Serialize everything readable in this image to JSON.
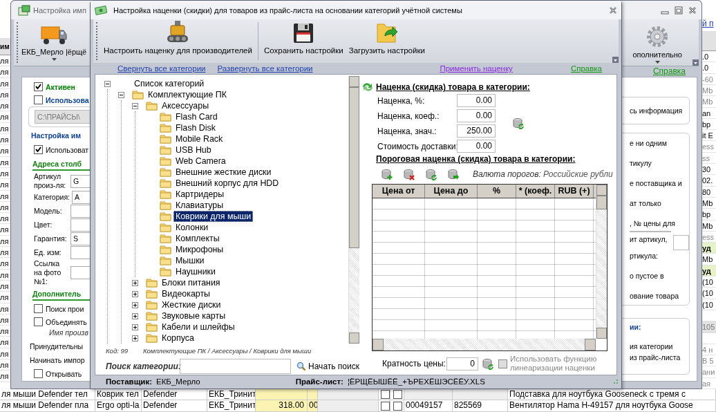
{
  "sheet": {
    "left_header": "им",
    "left_rows": [
      "ля",
      "ля",
      "ля",
      "ля",
      "ля",
      "ля",
      "ля",
      "ля",
      "ля",
      "ля",
      "ля",
      "ля",
      "ля",
      "ля",
      "ля",
      "ля",
      "ля",
      "ля",
      "ля",
      "ля",
      "ля",
      "ля",
      "ля",
      "ля",
      "ля",
      "ля",
      "ля",
      "ля",
      "ля"
    ],
    "right_link": "й п",
    "right_rows": [
      {
        "kind": "head"
      },
      {
        "kind": "plain",
        "text": ".0"
      },
      {
        "kind": "plain",
        "text": ".0"
      },
      {
        "kind": "dim",
        "text": "-60"
      },
      {
        "kind": "dim",
        "text": "Mb"
      },
      {
        "kind": "dim",
        "text": "Mb"
      },
      {
        "kind": "plain",
        "text": "an"
      },
      {
        "kind": "plain",
        "text": "bp"
      },
      {
        "kind": "plain",
        "text": "it E"
      },
      {
        "kind": "dim",
        "text": "ess"
      },
      {
        "kind": "dim",
        "text": "ss"
      },
      {
        "kind": "plain",
        "text": "30"
      },
      {
        "kind": "plain",
        "text": "02."
      },
      {
        "kind": "plain",
        "text": "80"
      },
      {
        "kind": "plain",
        "text": "Mb"
      },
      {
        "kind": "plain",
        "text": "bp"
      },
      {
        "kind": "plain",
        "text": "Mb"
      },
      {
        "kind": "dim",
        "text": "ess"
      },
      {
        "kind": "bold",
        "text": "уд"
      },
      {
        "kind": "plain",
        "text": "Mb"
      },
      {
        "kind": "bold",
        "text": "уд"
      },
      {
        "kind": "plain",
        "text": "(10"
      },
      {
        "kind": "plain",
        "text": "(10"
      },
      {
        "kind": "plain",
        "text": "(10"
      },
      {
        "kind": "blank"
      },
      {
        "kind": "headtext",
        "text": "105"
      },
      {
        "kind": "blank"
      },
      {
        "kind": "dim",
        "text": "4 н"
      },
      {
        "kind": "dim",
        "text": "В 5"
      },
      {
        "kind": "dim",
        "text": "ани"
      },
      {
        "kind": "dim",
        "text": "ая"
      }
    ],
    "bottom_rows": [
      {
        "cells": [
          {
            "kind": "text",
            "text": "ля мыши Defender тел"
          },
          {
            "kind": "text",
            "text": "Коврик тел"
          },
          {
            "kind": "text",
            "text": "Defender"
          },
          {
            "kind": "text",
            "text": "ЕКБ_Тринит"
          },
          {
            "kind": "price"
          },
          {
            "kind": "price"
          },
          {
            "kind": "blank"
          },
          {
            "kind": "checkbox",
            "checked": false
          },
          {
            "kind": "checkbox",
            "checked": false
          },
          {
            "kind": "blank"
          },
          {
            "kind": "blank"
          },
          {
            "kind": "text",
            "text": "Подставка для ноутбука Gooseneck  с тремя с"
          }
        ]
      },
      {
        "cells": [
          {
            "kind": "text",
            "text": "ля мыши Defender пла"
          },
          {
            "kind": "text",
            "text": "Ergo opti-la"
          },
          {
            "kind": "text",
            "text": "Defender"
          },
          {
            "kind": "text",
            "text": "ЕКБ_Тринит"
          },
          {
            "kind": "price",
            "text": "318.00"
          },
          {
            "kind": "price",
            "text": "00"
          },
          {
            "kind": "blank"
          },
          {
            "kind": "checkbox",
            "checked": false
          },
          {
            "kind": "checkbox",
            "checked": false
          },
          {
            "kind": "text",
            "text": "00049157"
          },
          {
            "kind": "text",
            "text": "825569"
          },
          {
            "kind": "text",
            "text": "Вентилятор Hama H-49157 для ноутбука Goose"
          }
        ]
      }
    ]
  },
  "back_window": {
    "title": "Настройка имп",
    "toolbar": [
      {
        "label": "ЕКБ_Мерло  |ёрщё"
      },
      {
        "label": "ополнительно"
      }
    ],
    "help_link": "Справка",
    "left_items": [
      {
        "kind": "checkbox",
        "label": "Активен",
        "checked": true,
        "color": "#008000"
      },
      {
        "kind": "checkbox",
        "label": "Использова",
        "checked": false,
        "color": "#0b3f8f"
      },
      {
        "kind": "path",
        "value": "C:\\ПРАЙСЫ\\",
        "disabled": true
      },
      {
        "kind": "group",
        "label": "Настройка им"
      },
      {
        "kind": "checkbox",
        "label": "Использоват",
        "checked": true
      },
      {
        "kind": "section",
        "label": "Адреса столб"
      },
      {
        "kind": "field",
        "label": "Артикул произ-ля:",
        "value": "G"
      },
      {
        "kind": "field",
        "label": "Категория:",
        "value": "A"
      },
      {
        "kind": "field",
        "label": "Модель:"
      },
      {
        "kind": "field",
        "label": "Цвет:"
      },
      {
        "kind": "field",
        "label": "Гарантия:",
        "value": "S"
      },
      {
        "kind": "field",
        "label": "Ед. изм:"
      },
      {
        "kind": "field",
        "label": "Ссылка на фото №1:"
      },
      {
        "kind": "section",
        "label": "Дополнитель"
      },
      {
        "kind": "checkbox",
        "label": "Поиск прои",
        "checked": false
      },
      {
        "kind": "checkbox",
        "label": "Объединять",
        "checked": false
      },
      {
        "kind": "note",
        "label": "Имя произв"
      },
      {
        "kind": "text",
        "label": "Принудительны"
      },
      {
        "kind": "text",
        "label": "Начинать импор"
      },
      {
        "kind": "checkbox",
        "label": "Открывать",
        "checked": false
      }
    ],
    "right_groups": [
      {
        "items": [
          {
            "kind": "text",
            "text": "сь информация"
          }
        ]
      },
      {
        "items": [
          {
            "kind": "text",
            "text": "е ни одним"
          },
          {
            "kind": "text",
            "text": "тикулу"
          },
          {
            "kind": "text",
            "text": "е поставщика и"
          },
          {
            "kind": "text",
            "text": "ат только"
          },
          {
            "kind": "text",
            "text": ", № цены для"
          },
          {
            "kind": "field"
          },
          {
            "kind": "text_field",
            "text": "ит артикул,"
          },
          {
            "kind": "text",
            "text": "ртикула:"
          },
          {
            "kind": "text",
            "text": "о пустое в"
          },
          {
            "kind": "text",
            "text": "ование товара"
          }
        ]
      },
      {
        "title": "ии:",
        "items": [
          {
            "kind": "text",
            "text": "ия  категории"
          },
          {
            "kind": "text",
            "text": "из прайс-листа"
          }
        ]
      }
    ]
  },
  "dialog": {
    "title": "Настройка наценки (скидки) для товаров из прайс-листа на основании категорий учётной системы",
    "toolbar": [
      {
        "label": "Настроить наценку для производителей"
      },
      {
        "label": "Сохранить настройки"
      },
      {
        "label": "Загрузить настройки"
      }
    ],
    "links": [
      {
        "label": "Свернуть все категории",
        "kind": "nav"
      },
      {
        "label": "Развернуть все категории",
        "kind": "nav"
      },
      {
        "label": "Применить наценку",
        "kind": "apply"
      },
      {
        "label": "Справка",
        "kind": "help"
      }
    ],
    "tree": [
      {
        "label": "Список категорий",
        "expanded": true,
        "selected": false,
        "children": [
          {
            "label": "Комплектующие ПК",
            "expanded": true,
            "selected": false,
            "children": [
              {
                "label": "Аксессуары",
                "expanded": true,
                "selected": false,
                "children": [
                  {
                    "label": "Flash Card",
                    "selected": false
                  },
                  {
                    "label": "Flash Disk",
                    "selected": false
                  },
                  {
                    "label": "Mobile Rack",
                    "selected": false
                  },
                  {
                    "label": "USB Hub",
                    "selected": false
                  },
                  {
                    "label": "Web Camera",
                    "selected": false
                  },
                  {
                    "label": "Внешние жесткие диски",
                    "selected": false
                  },
                  {
                    "label": "Внешний корпус для HDD",
                    "selected": false
                  },
                  {
                    "label": "Картридеры",
                    "selected": false
                  },
                  {
                    "label": "Клавиатуры",
                    "selected": false
                  },
                  {
                    "label": "Коврики для мыши",
                    "selected": true
                  },
                  {
                    "label": "Колонки",
                    "selected": false
                  },
                  {
                    "label": "Комплекты",
                    "selected": false
                  },
                  {
                    "label": "Микрофоны",
                    "selected": false
                  },
                  {
                    "label": "Мышки",
                    "selected": false
                  },
                  {
                    "label": "Наушники",
                    "selected": false
                  }
                ]
              },
              {
                "label": "Блоки питания",
                "expanded": false,
                "selected": false
              },
              {
                "label": "Видеокарты",
                "expanded": false,
                "selected": false
              },
              {
                "label": "Жесткие диски",
                "expanded": false,
                "selected": false
              },
              {
                "label": "Звуковые карты",
                "expanded": false,
                "selected": false
              },
              {
                "label": "Кабели и шлейфы",
                "expanded": false,
                "selected": false
              },
              {
                "label": "Корпуса",
                "expanded": false,
                "selected": false
              }
            ]
          }
        ]
      }
    ],
    "code": "Код: 99",
    "path": "Комплектующие ПК / Аксессуары / Коврики для мыши",
    "search": {
      "label": "Поиск категории:",
      "button": "Начать поиск"
    },
    "markup": {
      "title": "Наценка (скидка) товара в категории:",
      "fields": [
        {
          "label": "Наценка, %:",
          "value": "0.00"
        },
        {
          "label": "Наценка, коеф.:",
          "value": "0.00"
        },
        {
          "label": "Наценка, знач.:",
          "value": "250.00"
        },
        {
          "label": "Стоимость доставки:",
          "value": "0.00"
        }
      ],
      "threshold_title": "Пороговая наценка (скидка) товара в категории:",
      "currency_label": "Валюта порогов:",
      "currency": "Российские рубли",
      "columns": [
        "Цена от",
        "Цена до",
        "%",
        "* (коеф.",
        "RUB (+)"
      ],
      "multiple": {
        "label": "Кратность цены:",
        "value": "0"
      },
      "linearize": {
        "label": "Использовать функцию линеаризации наценки",
        "checked": false,
        "disabled": true
      }
    },
    "status": [
      {
        "label": "Поставщик:",
        "value": "ЕКБ_Мерло"
      },
      {
        "label": "Прайс-лист:",
        "value": "¦ЁРЩЁЫШЁЁ_+ЪРЕХЁШЭСЁЁУ.XLS"
      }
    ]
  }
}
